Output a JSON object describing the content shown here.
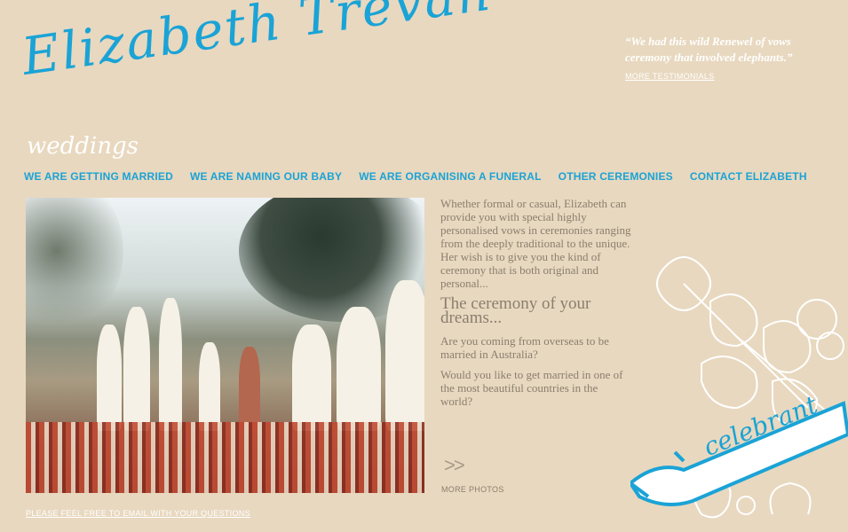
{
  "brand": {
    "logo_text": "Elizabeth Trevan",
    "accent_color": "#1aa3d6"
  },
  "testimonial": {
    "quote": "“We had this wild Renewel of vows ceremony that involved elephants.”",
    "link": "MORE TESTIMONIALS"
  },
  "section_title": "weddings",
  "nav": {
    "items": [
      "WE ARE GETTING MARRIED",
      "WE ARE NAMING OUR BABY",
      "WE ARE ORGANISING A FUNERAL",
      "OTHER CEREMONIES",
      "CONTACT ELIZABETH"
    ]
  },
  "content": {
    "intro": "Whether formal or casual, Elizabeth can provide you with special highly personalised vows in ceremonies ranging from the deeply traditional to the unique. Her wish is to give you the kind of ceremony that is both original and personal...",
    "heading": "The ceremony of your dreams...",
    "para2": "Are you coming from overseas to be married in Australia?",
    "para3": "Would you like to get married in one of the most beautiful countries in the world?"
  },
  "photos": {
    "arrow": ">>",
    "label": "MORE PHOTOS"
  },
  "footer": {
    "email_link": "PLEASE FEEL FREE TO EMAIL WITH YOUR QUESTIONS"
  },
  "decoration": {
    "banner_text": "celebrant"
  }
}
